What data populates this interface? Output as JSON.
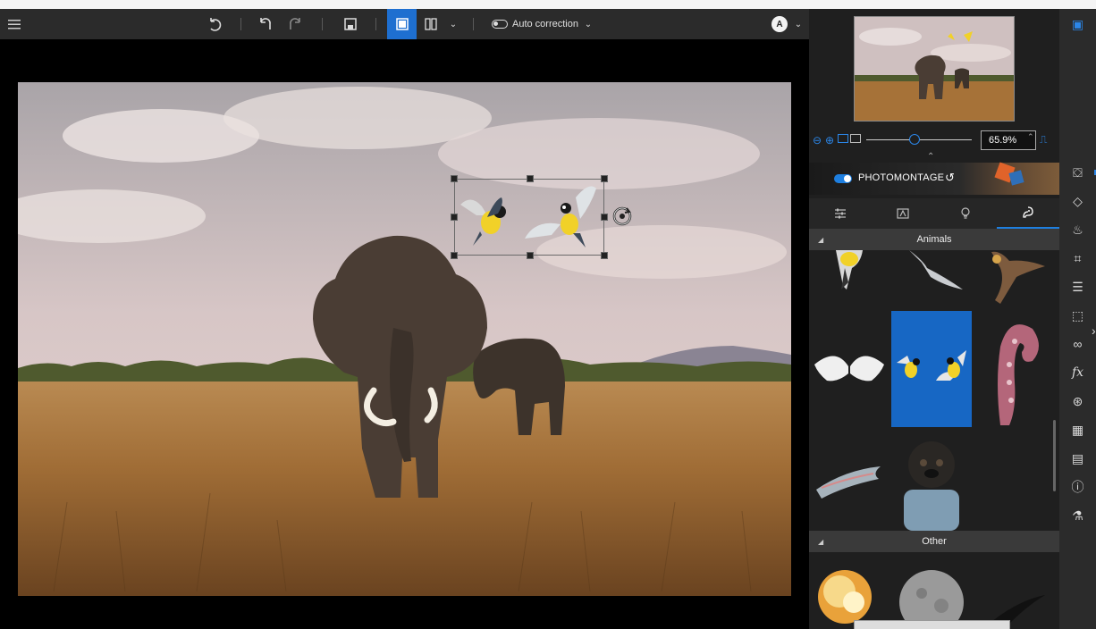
{
  "toolbar": {
    "menu_icon": "hamburger-menu-icon",
    "auto_correction_label": "Auto correction",
    "avatar_letter": "A"
  },
  "panel": {
    "zoom_value": "65.9%",
    "photomontage_label": "PHOTOMONTAGE",
    "sections": [
      {
        "title": "Animals"
      },
      {
        "title": "Other"
      }
    ],
    "tabs": [
      {
        "icon": "sliders-icon"
      },
      {
        "icon": "text-frame-icon"
      },
      {
        "icon": "lightbulb-icon"
      },
      {
        "icon": "paint-stamp-icon"
      }
    ]
  },
  "colors": {
    "accent": "#1e6fd0",
    "panel_bg": "#1f1f1f",
    "toolbar_bg": "#2b2b2b"
  }
}
